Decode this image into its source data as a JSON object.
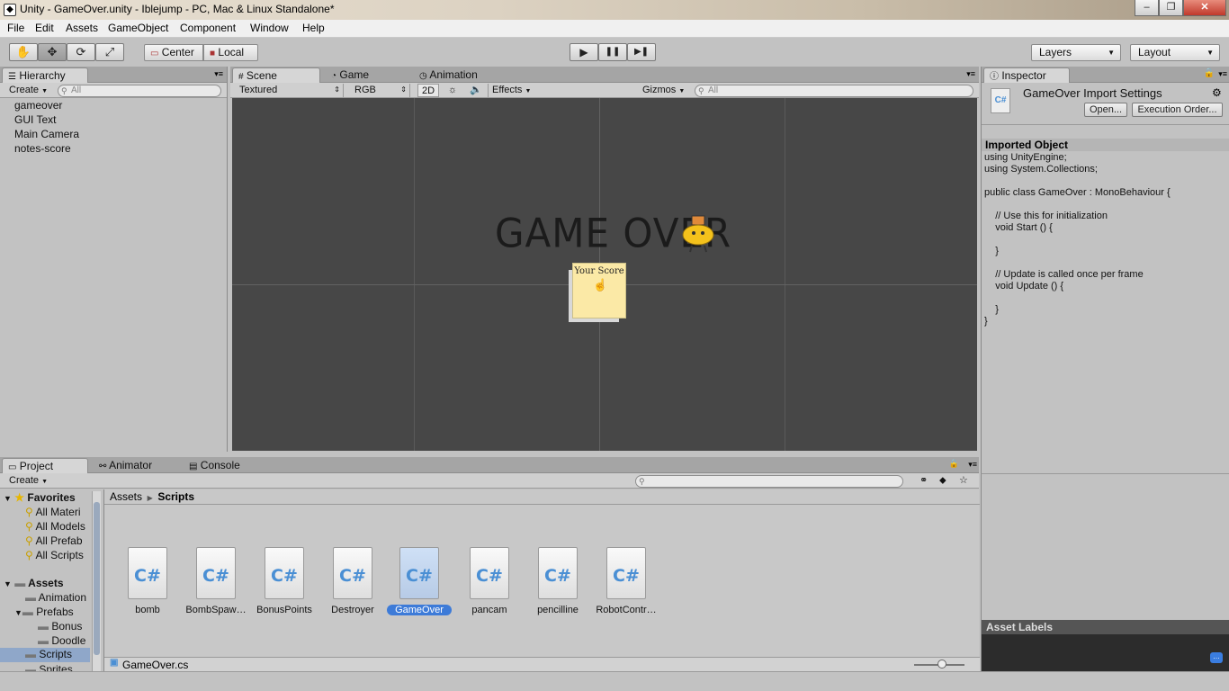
{
  "window": {
    "title": "Unity - GameOver.unity - Iblejump - PC, Mac & Linux Standalone*",
    "controls": {
      "minimize": "–",
      "maximize": "❐",
      "close": "✕"
    }
  },
  "menu": [
    "File",
    "Edit",
    "Assets",
    "GameObject",
    "Component",
    "Window",
    "Help"
  ],
  "toolbar": {
    "tools": [
      {
        "name": "hand-tool",
        "glyph": "✋"
      },
      {
        "name": "move-tool",
        "glyph": "✥"
      },
      {
        "name": "rotate-tool",
        "glyph": "⟳"
      },
      {
        "name": "scale-tool",
        "glyph": "⤢"
      }
    ],
    "pivot_center": "Center",
    "pivot_local": "Local",
    "play": "▶",
    "pause": "❚❚",
    "step": "▶❚",
    "layers": "Layers",
    "layout": "Layout"
  },
  "hierarchy": {
    "tab": "Hierarchy",
    "create": "Create",
    "search_placeholder": "All",
    "items": [
      "gameover",
      "GUI Text",
      "Main Camera",
      "notes-score"
    ]
  },
  "scene": {
    "tabs": [
      "Scene",
      "Game",
      "Animation"
    ],
    "shading": "Textured",
    "render_mode": "RGB",
    "mode_2d": "2D",
    "effects": "Effects",
    "gizmos": "Gizmos",
    "search_placeholder": "All",
    "game_over_text": "GAME OVER",
    "note_text": "Your Score"
  },
  "inspector": {
    "tab": "Inspector",
    "title": "GameOver Import Settings",
    "open_button": "Open...",
    "execution_order_button": "Execution Order...",
    "section": "Imported Object",
    "code": "using UnityEngine;\nusing System.Collections;\n\npublic class GameOver : MonoBehaviour {\n\n    // Use this for initialization\n    void Start () {\n\n    }\n\n    // Update is called once per frame\n    void Update () {\n\n    }\n}",
    "asset_labels": "Asset Labels"
  },
  "project": {
    "tabs": [
      "Project",
      "Animator",
      "Console"
    ],
    "create": "Create",
    "favorites_label": "Favorites",
    "favorites": [
      "All Materi",
      "All Models",
      "All Prefab",
      "All Scripts"
    ],
    "assets_label": "Assets",
    "folders": [
      {
        "label": "Animation",
        "indent": 1
      },
      {
        "label": "Prefabs",
        "indent": 1
      },
      {
        "label": "Bonus",
        "indent": 2
      },
      {
        "label": "Doodle",
        "indent": 2
      },
      {
        "label": "Scripts",
        "indent": 1
      },
      {
        "label": "Sprites",
        "indent": 1
      }
    ],
    "breadcrumb_root": "Assets",
    "breadcrumb_current": "Scripts",
    "assets": [
      "bomb",
      "BombSpaw…",
      "BonusPoints",
      "Destroyer",
      "GameOver",
      "pancam",
      "pencilline",
      "RobotContr…"
    ],
    "selected_asset": "GameOver",
    "selected_path": "GameOver.cs",
    "cs_glyph": "C#"
  }
}
